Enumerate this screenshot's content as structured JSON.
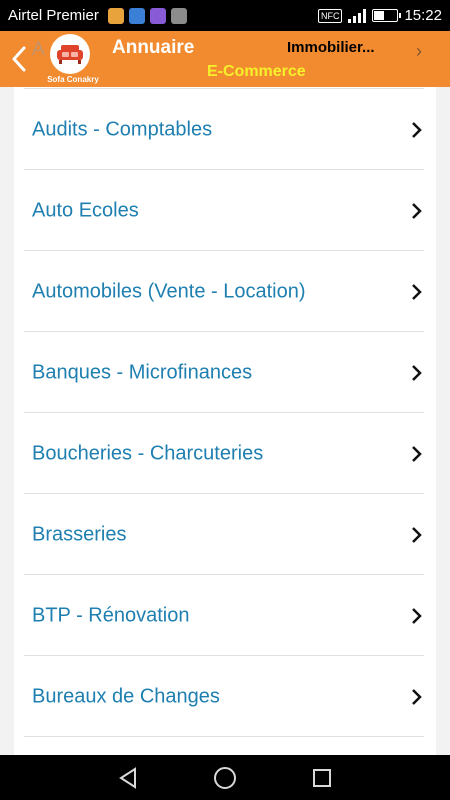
{
  "status_bar": {
    "carrier": "Airtel Premier",
    "time": "15:22",
    "nfc": "NFC",
    "notification_icons": [
      "download-icon",
      "app-icon",
      "image-icon",
      "photo-icon"
    ]
  },
  "header": {
    "title": "Annuaire",
    "subtitle": "E-Commerce",
    "tab_label": "Immobilier...",
    "logo_caption": "Sofa Conakry",
    "background_color": "#f28b30",
    "subtitle_color": "#f5f02a"
  },
  "list": {
    "items": [
      {
        "label": "Audits - Comptables"
      },
      {
        "label": "Auto Ecoles"
      },
      {
        "label": "Automobiles (Vente - Location)"
      },
      {
        "label": "Banques - Microfinances"
      },
      {
        "label": "Boucheries - Charcuteries"
      },
      {
        "label": "Brasseries"
      },
      {
        "label": "BTP - Rénovation"
      },
      {
        "label": "Bureaux de Changes"
      }
    ],
    "label_color": "#1e7fb0"
  },
  "nav_bar": {
    "buttons": [
      "back-triangle-icon",
      "home-circle-icon",
      "recents-square-icon"
    ]
  }
}
